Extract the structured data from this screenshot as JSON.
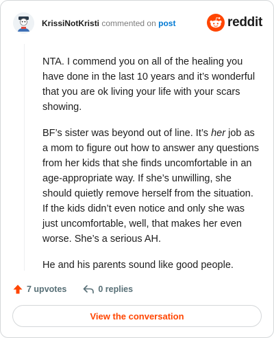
{
  "header": {
    "author": "KrissiNotKristi",
    "connector": "commented on",
    "post_link": "post",
    "brand": "reddit"
  },
  "comment": {
    "paragraph_1": "NTA. I commend you on all of the healing you have done in the last 10 years and it’s wonderful that you are ok living your life with your scars showing.",
    "paragraph_2_before": "BF’s sister was beyond out of line. It’s ",
    "paragraph_2_emphasis": "her",
    "paragraph_2_after": " job as a mom to figure out how to answer any questions from her kids that she finds uncomfortable in an age-appropriate way. If she’s unwilling, she should quietly remove herself from the situation. If the kids didn’t even notice and only she was just uncomfortable, well, that makes her even worse. She’s a serious AH.",
    "paragraph_3": "He and his parents sound like good people."
  },
  "actions": {
    "upvotes": "7 upvotes",
    "replies": "0 replies"
  },
  "cta": {
    "label": "View the conversation"
  },
  "colors": {
    "brand": "#ff4500",
    "link": "#0079d3",
    "text": "#1c1c1c",
    "muted": "#576f76"
  },
  "icons": [
    "avatar-icon",
    "reddit-logo-icon",
    "upvote-arrow-icon",
    "reply-icon"
  ]
}
